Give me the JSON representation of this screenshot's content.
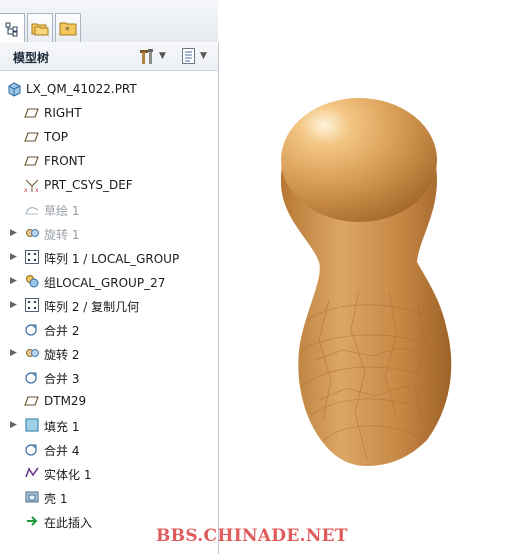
{
  "tabs": [
    {
      "icon": "model-tree-icon",
      "active": true
    },
    {
      "icon": "folder-browser-icon",
      "active": false
    },
    {
      "icon": "favorites-icon",
      "active": false
    }
  ],
  "panel": {
    "title": "模型树",
    "settings_icon": "tools-icon",
    "show_icon": "list-settings-icon"
  },
  "tree": [
    {
      "label": "LX_QM_41022.PRT",
      "icon": "part-icon",
      "indent": 0,
      "expander": false,
      "dim": false
    },
    {
      "label": "RIGHT",
      "icon": "datum-plane-icon",
      "indent": 1,
      "expander": false,
      "dim": false
    },
    {
      "label": "TOP",
      "icon": "datum-plane-icon",
      "indent": 1,
      "expander": false,
      "dim": false
    },
    {
      "label": "FRONT",
      "icon": "datum-plane-icon",
      "indent": 1,
      "expander": false,
      "dim": false
    },
    {
      "label": "PRT_CSYS_DEF",
      "icon": "csys-icon",
      "indent": 1,
      "expander": false,
      "dim": false
    },
    {
      "label": "草绘 1",
      "icon": "sketch-icon",
      "indent": 1,
      "expander": false,
      "dim": true
    },
    {
      "label": "旋转 1",
      "icon": "revolve-icon",
      "indent": 1,
      "expander": true,
      "dim": true
    },
    {
      "label": "阵列 1 / LOCAL_GROUP",
      "icon": "pattern-icon",
      "indent": 1,
      "expander": true,
      "dim": false
    },
    {
      "label": "组LOCAL_GROUP_27",
      "icon": "group-icon",
      "indent": 1,
      "expander": true,
      "dim": false
    },
    {
      "label": "阵列 2 / 复制几何",
      "icon": "pattern-icon",
      "indent": 1,
      "expander": true,
      "dim": false
    },
    {
      "label": "合并 2",
      "icon": "merge-icon",
      "indent": 1,
      "expander": false,
      "dim": false
    },
    {
      "label": "旋转 2",
      "icon": "revolve-icon",
      "indent": 1,
      "expander": true,
      "dim": false
    },
    {
      "label": "合并 3",
      "icon": "merge-icon",
      "indent": 1,
      "expander": false,
      "dim": false
    },
    {
      "label": "DTM29",
      "icon": "datum-plane-icon",
      "indent": 1,
      "expander": false,
      "dim": false
    },
    {
      "label": "填充 1",
      "icon": "fill-icon",
      "indent": 1,
      "expander": true,
      "dim": false
    },
    {
      "label": "合并 4",
      "icon": "merge-icon",
      "indent": 1,
      "expander": false,
      "dim": false
    },
    {
      "label": "实体化 1",
      "icon": "solidify-icon",
      "indent": 1,
      "expander": false,
      "dim": false
    },
    {
      "label": "壳 1",
      "icon": "shell-icon",
      "indent": 1,
      "expander": false,
      "dim": false
    },
    {
      "label": "在此插入",
      "icon": "insert-here-icon",
      "indent": 1,
      "expander": false,
      "dim": false
    }
  ],
  "viewport": {
    "model_color": "#c98a46",
    "watermark": "BBS.CHINADE.NET"
  }
}
